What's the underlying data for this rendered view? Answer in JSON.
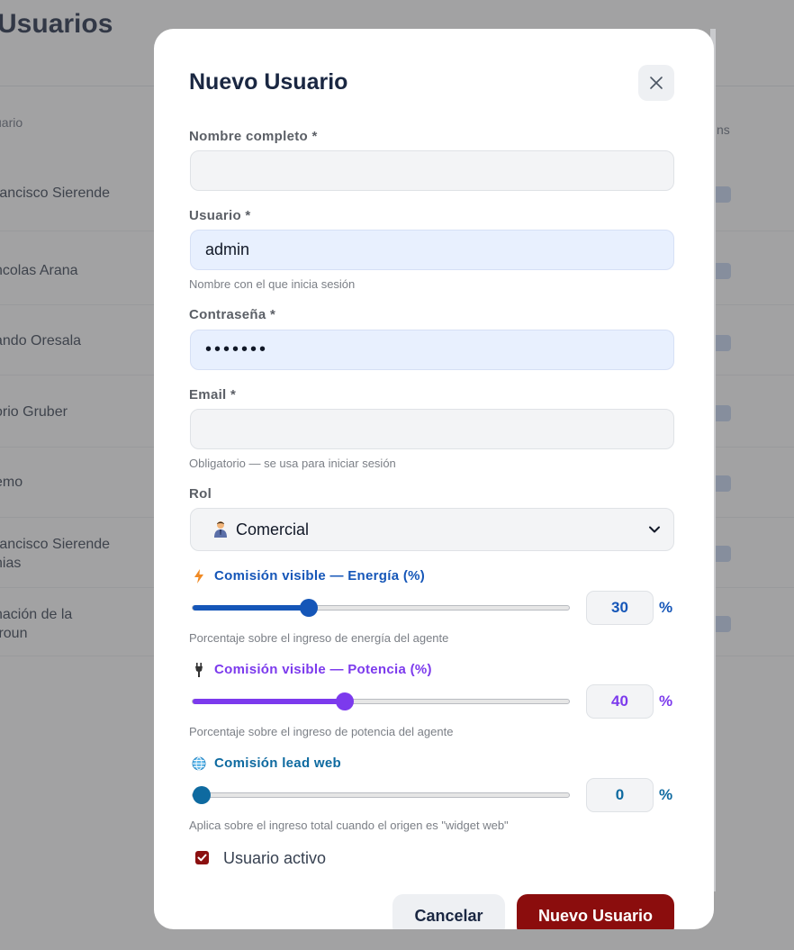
{
  "background": {
    "page_title": "e Usuarios",
    "column_header_left": "uario",
    "column_header_right": "ns",
    "rows": [
      "rancisco Sierende",
      "ncolas Arana",
      "ando Oresala",
      "orio Gruber",
      "emo",
      "rancisco Sierende\nnias",
      "nación de la\nfroun"
    ]
  },
  "modal": {
    "title": "Nuevo Usuario",
    "close_icon": "close-icon",
    "fields": {
      "full_name": {
        "label": "Nombre completo *",
        "value": ""
      },
      "username": {
        "label": "Usuario *",
        "value": "admin",
        "hint": "Nombre con el que inicia sesión"
      },
      "password": {
        "label": "Contraseña *",
        "value": "•••••••"
      },
      "email": {
        "label": "Email *",
        "value": "",
        "hint": "Obligatorio — se usa para iniciar sesión"
      },
      "role": {
        "label": "Rol",
        "value": "Comercial",
        "icon": "person-office-worker-icon"
      }
    },
    "sliders": {
      "energy": {
        "label": "Comisión visible — Energía (%)",
        "icon": "lightning-icon",
        "value": "30",
        "percent": 30,
        "unit": "%",
        "hint": "Porcentaje sobre el ingreso de energía del agente",
        "color": "#1556b8"
      },
      "power": {
        "label": "Comisión visible — Potencia (%)",
        "icon": "plug-icon",
        "value": "40",
        "percent": 40,
        "unit": "%",
        "hint": "Porcentaje sobre el ingreso de potencia del agente",
        "color": "#7c3aed"
      },
      "web": {
        "label": "Comisión lead web",
        "icon": "globe-icon",
        "value": "0",
        "percent": 0,
        "unit": "%",
        "hint": "Aplica sobre el ingreso total cuando el origen es \"widget web\"",
        "color": "#0e6aa0"
      }
    },
    "active_checkbox": {
      "label": "Usuario activo",
      "checked": true
    },
    "buttons": {
      "cancel": "Cancelar",
      "submit": "Nuevo Usuario"
    },
    "accent_color": "#8b0d0d"
  }
}
